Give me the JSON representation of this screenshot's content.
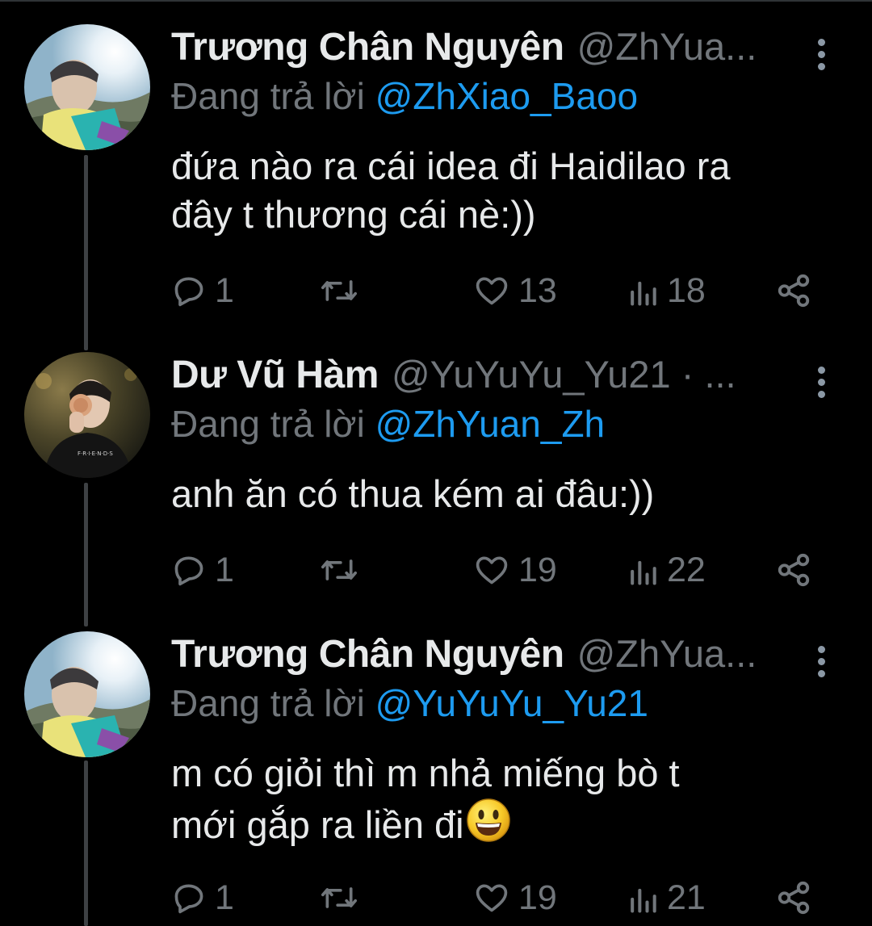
{
  "colors": {
    "background": "#000000",
    "text": "#e7e9ea",
    "muted": "#71767b",
    "mention": "#1d9bf0"
  },
  "reply_prefix": "Đang trả lời",
  "tweets": [
    {
      "name": "Trương Chân Nguyên",
      "handle": "@ZhYua...",
      "reply_to": "@ZhXiao_Baoo",
      "text": "đứa nào ra cái idea đi Haidilao ra\nđây t thương cái nè:))",
      "emoji": "",
      "stats": {
        "replies": "1",
        "retweets": "",
        "likes": "13",
        "views": "18"
      }
    },
    {
      "name": "Dư Vũ Hàm",
      "handle": "@YuYuYu_Yu21 · ...",
      "reply_to": "@ZhYuan_Zh",
      "text": "anh ăn có thua kém ai đâu:))",
      "emoji": "",
      "stats": {
        "replies": "1",
        "retweets": "",
        "likes": "19",
        "views": "22"
      }
    },
    {
      "name": "Trương Chân Nguyên",
      "handle": "@ZhYua...",
      "reply_to": "@YuYuYu_Yu21",
      "text": "m có giỏi thì m nhả miếng bò t\nmới gắp ra liền đi",
      "emoji": "grinning-face",
      "stats": {
        "replies": "1",
        "retweets": "",
        "likes": "19",
        "views": "21"
      }
    }
  ],
  "icons": [
    "reply-icon",
    "retweet-icon",
    "like-icon",
    "views-icon",
    "share-icon",
    "more-icon"
  ]
}
